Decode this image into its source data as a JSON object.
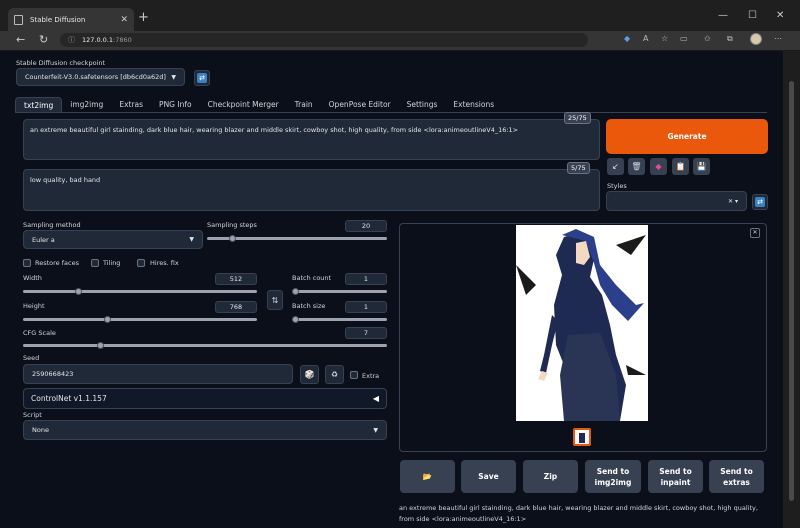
{
  "browser": {
    "tab_title": "Stable Diffusion",
    "tab_close": "✕",
    "new_tab": "+",
    "url_host": "127.0.0.1",
    "url_port": ":7860",
    "win_min": "—",
    "win_max": "☐",
    "win_close": "✕"
  },
  "checkpoint": {
    "label": "Stable Diffusion checkpoint",
    "value": "Counterfeit-V3.0.safetensors [db6cd0a62d]"
  },
  "tabs": [
    "txt2img",
    "img2img",
    "Extras",
    "PNG Info",
    "Checkpoint Merger",
    "Train",
    "OpenPose Editor",
    "Settings",
    "Extensions"
  ],
  "prompt": {
    "text": "an extreme beautiful girl stainding, dark blue hair, wearing blazer and middle skirt, cowboy shot, high quality, from side <lora:animeoutlineV4_16:1>",
    "counter": "25/75"
  },
  "negative": {
    "text": "low quality, bad hand",
    "counter": "5/75"
  },
  "generate_label": "Generate",
  "styles_label": "Styles",
  "sampling": {
    "method_label": "Sampling method",
    "method_value": "Euler a",
    "steps_label": "Sampling steps",
    "steps_value": "20",
    "steps_level": 0.13
  },
  "checks": {
    "restore_faces": "Restore faces",
    "tiling": "Tiling",
    "hires": "Hires. fix"
  },
  "size": {
    "width_label": "Width",
    "width_value": "512",
    "height_label": "Height",
    "height_value": "768",
    "batch_count_label": "Batch count",
    "batch_count_value": "1",
    "batch_size_label": "Batch size",
    "batch_size_value": "1"
  },
  "cfg": {
    "label": "CFG Scale",
    "value": "7"
  },
  "seed": {
    "label": "Seed",
    "value": "2590668423",
    "extra": "Extra"
  },
  "controlnet": {
    "label": "ControlNet v1.1.157",
    "arrow": "◀"
  },
  "script": {
    "label": "Script",
    "value": "None"
  },
  "actions": [
    "📂",
    "Save",
    "Zip",
    "Send to img2img",
    "Send to inpaint",
    "Send to extras"
  ],
  "output_caption": "an extreme beautiful girl stainding, dark blue hair, wearing blazer and middle skirt, cowboy shot, high quality, from side <lora:animeoutlineV4_16:1>",
  "colors": {
    "accent": "#ea580c",
    "panel": "#1f2937",
    "bg": "#0b0f19"
  }
}
